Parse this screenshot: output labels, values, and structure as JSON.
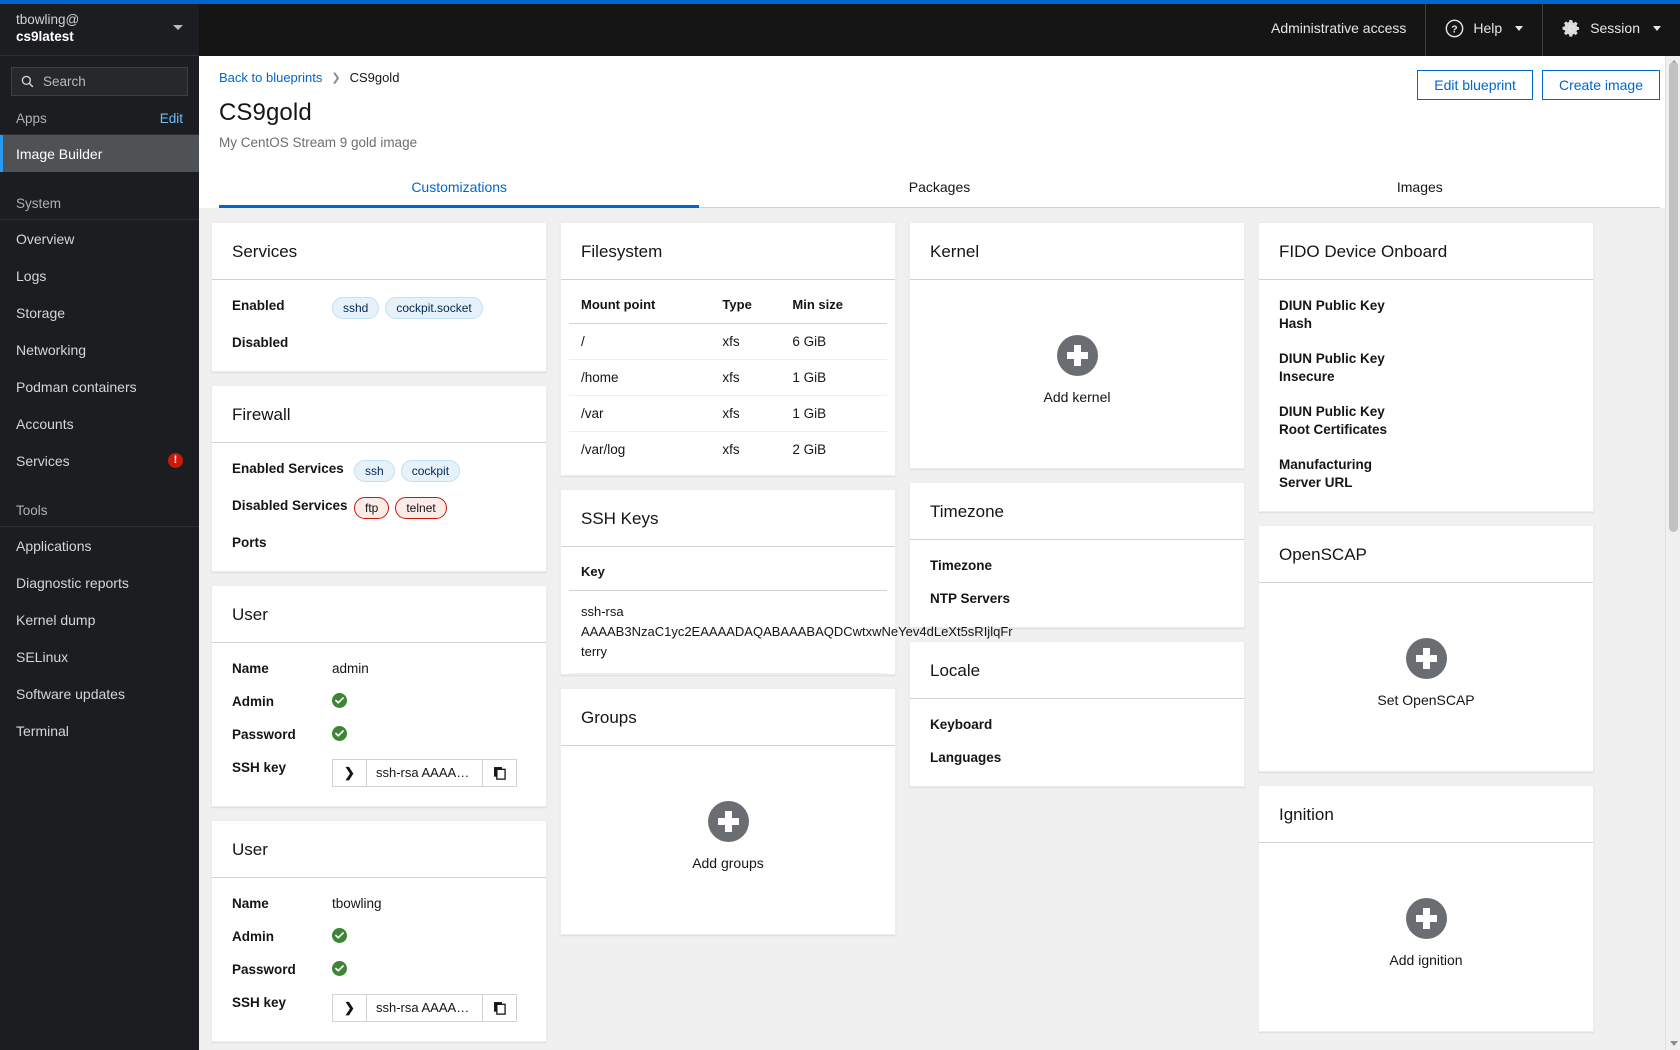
{
  "sidebar": {
    "account": {
      "user": "tbowling@",
      "host": "cs9latest"
    },
    "search_placeholder": "Search",
    "apps_label": "Apps",
    "edit_label": "Edit",
    "apps_items": [
      {
        "label": "Image Builder",
        "active": true
      }
    ],
    "system_label": "System",
    "system_items": [
      {
        "label": "Overview"
      },
      {
        "label": "Logs"
      },
      {
        "label": "Storage"
      },
      {
        "label": "Networking"
      },
      {
        "label": "Podman containers"
      },
      {
        "label": "Accounts"
      },
      {
        "label": "Services",
        "badge": "!"
      }
    ],
    "tools_label": "Tools",
    "tools_items": [
      {
        "label": "Applications"
      },
      {
        "label": "Diagnostic reports"
      },
      {
        "label": "Kernel dump"
      },
      {
        "label": "SELinux"
      },
      {
        "label": "Software updates"
      },
      {
        "label": "Terminal"
      }
    ]
  },
  "masthead": {
    "admin_access": "Administrative access",
    "help": "Help",
    "session": "Session"
  },
  "page": {
    "breadcrumb_back": "Back to blueprints",
    "breadcrumb_current": "CS9gold",
    "title": "CS9gold",
    "subtitle": "My CentOS Stream 9 gold image",
    "edit_blueprint": "Edit blueprint",
    "create_image": "Create image",
    "tabs": [
      {
        "label": "Customizations",
        "active": true
      },
      {
        "label": "Packages",
        "active": false
      },
      {
        "label": "Images",
        "active": false
      }
    ]
  },
  "cards": {
    "services": {
      "title": "Services",
      "enabled_label": "Enabled",
      "enabled": [
        "sshd",
        "cockpit.socket"
      ],
      "disabled_label": "Disabled",
      "disabled": []
    },
    "firewall": {
      "title": "Firewall",
      "enabled_label": "Enabled Services",
      "enabled": [
        "ssh",
        "cockpit"
      ],
      "disabled_label": "Disabled Services",
      "disabled": [
        "ftp",
        "telnet"
      ],
      "ports_label": "Ports",
      "ports": []
    },
    "user1": {
      "title": "User",
      "name_label": "Name",
      "name": "admin",
      "admin_label": "Admin",
      "admin": true,
      "password_label": "Password",
      "password": true,
      "sshkey_label": "SSH key",
      "sshkey_value": "ssh-rsa AAAA…",
      "toggle_glyph": "❯"
    },
    "user2": {
      "title": "User",
      "name_label": "Name",
      "name": "tbowling",
      "admin_label": "Admin",
      "admin": true,
      "password_label": "Password",
      "password": true,
      "sshkey_label": "SSH key",
      "sshkey_value": "ssh-rsa AAAA…",
      "toggle_glyph": "❯"
    },
    "filesystem": {
      "title": "Filesystem",
      "columns": [
        "Mount point",
        "Type",
        "Min size"
      ],
      "rows": [
        [
          "/",
          "xfs",
          "6 GiB"
        ],
        [
          "/home",
          "xfs",
          "1 GiB"
        ],
        [
          "/var",
          "xfs",
          "1 GiB"
        ],
        [
          "/var/log",
          "xfs",
          "2 GiB"
        ]
      ]
    },
    "sshkeys": {
      "title": "SSH Keys",
      "column": "Key",
      "rows": [
        "ssh-rsa\nAAAAB3NzaC1yc2EAAAADAQABAAABAQDCwtxwNeYev4dLeXt5sRIjlqFr\nterry"
      ]
    },
    "groups": {
      "title": "Groups",
      "add_label": "Add groups"
    },
    "kernel": {
      "title": "Kernel",
      "add_label": "Add kernel"
    },
    "timezone": {
      "title": "Timezone",
      "timezone_label": "Timezone",
      "timezone": "",
      "ntp_label": "NTP Servers",
      "ntp": ""
    },
    "locale": {
      "title": "Locale",
      "keyboard_label": "Keyboard",
      "keyboard": "",
      "languages_label": "Languages",
      "languages": ""
    },
    "fido": {
      "title": "FIDO Device Onboard",
      "items": [
        {
          "label": "DIUN Public Key Hash",
          "value": ""
        },
        {
          "label": "DIUN Public Key Insecure",
          "value": ""
        },
        {
          "label": "DIUN Public Key Root Certificates",
          "value": ""
        },
        {
          "label": "Manufacturing Server URL",
          "value": ""
        }
      ]
    },
    "openscap": {
      "title": "OpenSCAP",
      "add_label": "Set OpenSCAP"
    },
    "ignition": {
      "title": "Ignition",
      "add_label": "Add ignition"
    }
  },
  "colors": {
    "accent_blue": "#06c",
    "alert_red": "#c9190b",
    "success_green": "#3e8635",
    "sidebar_bg": "#1b1d21"
  }
}
